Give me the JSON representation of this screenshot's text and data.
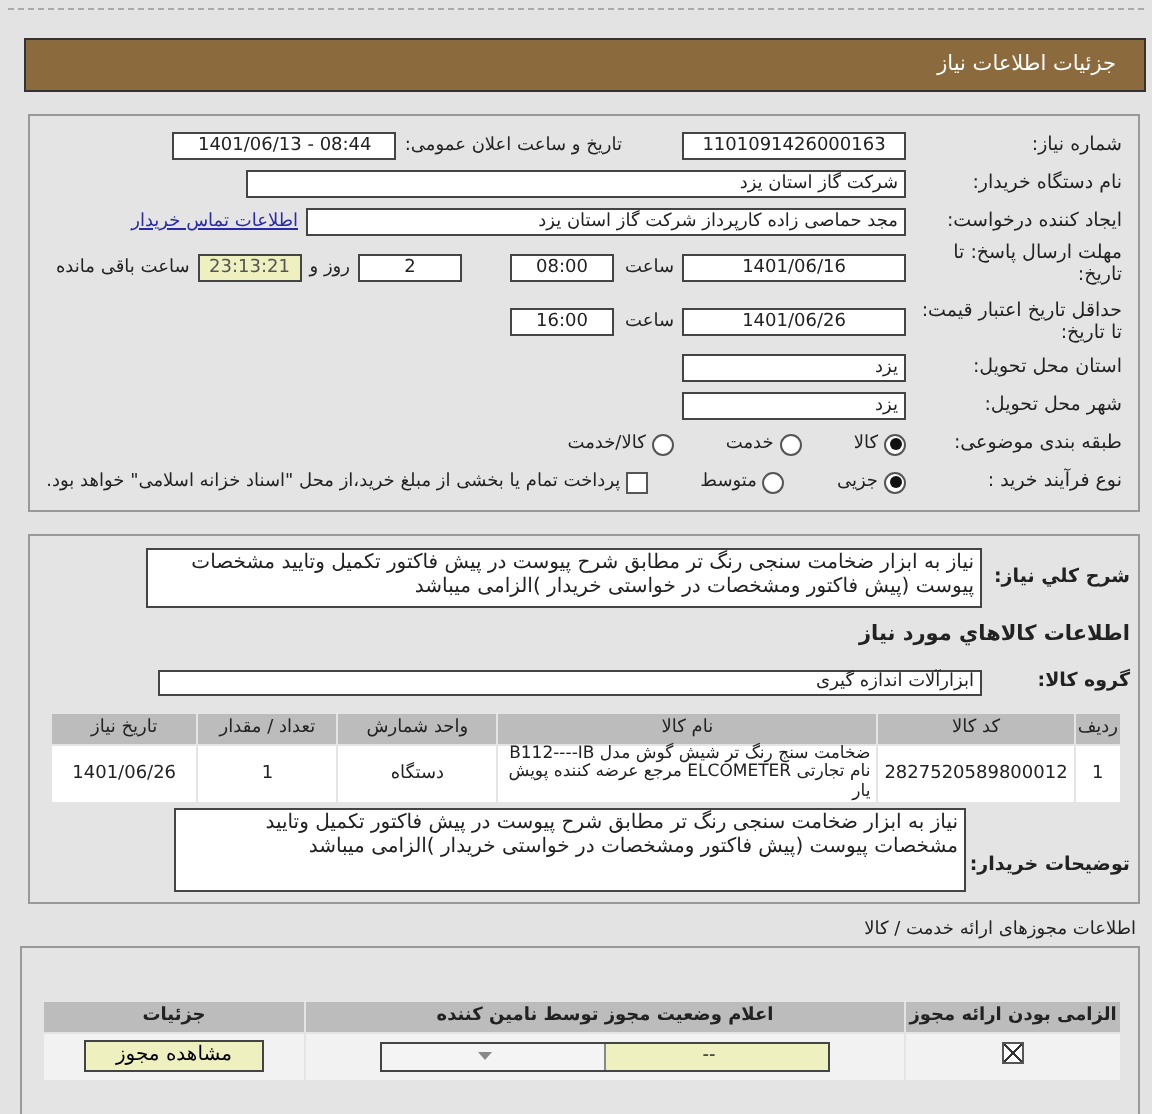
{
  "header": {
    "title": "جزئیات اطلاعات نیاز"
  },
  "need_number": {
    "label": "شماره نیاز:",
    "value": "1101091426000163"
  },
  "announce": {
    "label": "تاریخ و ساعت اعلان عمومی:",
    "value": "1401/06/13 - 08:44"
  },
  "buyer": {
    "label": "نام دستگاه خریدار:",
    "value": "شرکت گاز استان یزد"
  },
  "creator": {
    "label": "ایجاد کننده درخواست:",
    "value": "مجد حماصی زاده کارپرداز شرکت گاز استان یزد",
    "link": "اطلاعات تماس خریدار"
  },
  "deadline": {
    "label": "مهلت ارسال پاسخ: تا تاریخ:",
    "date": "1401/06/16",
    "time_label": "ساعت",
    "time": "08:00",
    "days": "2",
    "days_label": "روز و",
    "remaining": "23:13:21",
    "remaining_label": "ساعت باقی مانده"
  },
  "validity": {
    "label": "حداقل تاریخ اعتبار قیمت: تا تاریخ:",
    "date": "1401/06/26",
    "time_label": "ساعت",
    "time": "16:00"
  },
  "province": {
    "label": "استان محل تحویل:",
    "value": "یزد"
  },
  "city": {
    "label": "شهر محل تحویل:",
    "value": "یزد"
  },
  "category": {
    "label": "طبقه بندی موضوعی:",
    "options": [
      {
        "label": "کالا",
        "selected": true
      },
      {
        "label": "خدمت",
        "selected": false
      },
      {
        "label": "کالا/خدمت",
        "selected": false
      }
    ]
  },
  "process": {
    "label": "نوع فرآیند خرید :",
    "options": [
      {
        "label": "جزیی",
        "selected": true
      },
      {
        "label": "متوسط",
        "selected": false
      }
    ],
    "payment": {
      "label": "پرداخت تمام یا بخشی از مبلغ خرید،از محل \"اسناد خزانه اسلامی\" خواهد بود.",
      "checked": false
    }
  },
  "description": {
    "label": "شرح کلي نیاز:",
    "value": "نیاز به ابزار ضخامت سنجی رنگ تر مطابق شرح پیوست در پیش فاکتور تکمیل وتایید مشخصات پیوست (پیش فاکتور ومشخصات در خواستی خریدار )الزامی میباشد"
  },
  "goods_title": "اطلاعات کالاهاي مورد نیاز",
  "group": {
    "label": "گروه کالا:",
    "value": "ابزارآلات اندازه گیری"
  },
  "goods_table": {
    "columns": [
      "ردیف",
      "کد کالا",
      "نام کالا",
      "واحد شمارش",
      "تعداد / مقدار",
      "تاریخ نیاز"
    ],
    "rows": [
      [
        "1",
        "2827520589800012",
        "ضخامت سنج رنگ تر شیش گوش مدل B112----IB نام تجارتی ELCOMETER مرجع عرضه کننده پویش یار",
        "دستگاه",
        "1",
        "1401/06/26"
      ]
    ]
  },
  "buyer_notes": {
    "label": "توضیحات خریدار:",
    "value": "نیاز به ابزار ضخامت سنجی رنگ تر مطابق شرح پیوست در پیش فاکتور تکمیل وتایید مشخصات پیوست (پیش فاکتور ومشخصات در خواستی خریدار )الزامی میباشد"
  },
  "permits": {
    "title": "اطلاعات مجوزهای ارائه خدمت / کالا",
    "columns": [
      "الزامی بودن ارائه مجوز",
      "اعلام وضعیت مجوز توسط نامین کننده",
      "جزئیات"
    ],
    "rows": [
      {
        "required": true,
        "status": "--",
        "button": "مشاهده مجوز"
      }
    ]
  }
}
